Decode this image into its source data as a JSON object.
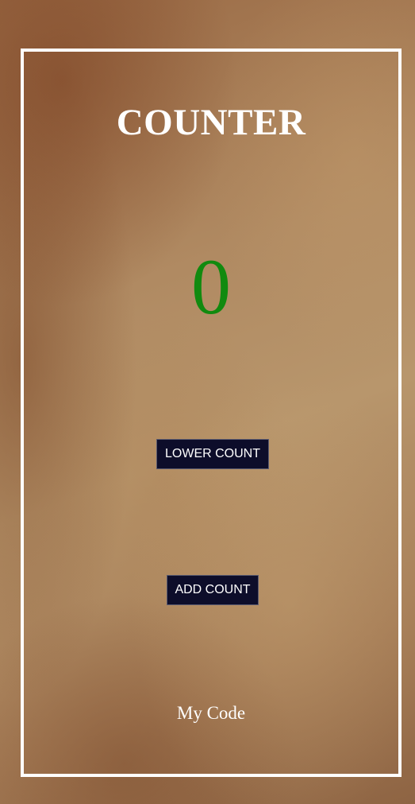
{
  "app": {
    "title": "COUNTER",
    "count_value": "0",
    "count_color": "#118a0f"
  },
  "buttons": {
    "lower_label": "LOWER COUNT",
    "add_label": "ADD COUNT"
  },
  "footer": {
    "text": "My Code"
  },
  "colors": {
    "frame_border": "#ffffff",
    "button_background": "#0d0d2a",
    "button_text": "#ffffff",
    "title_text": "#ffffff"
  }
}
